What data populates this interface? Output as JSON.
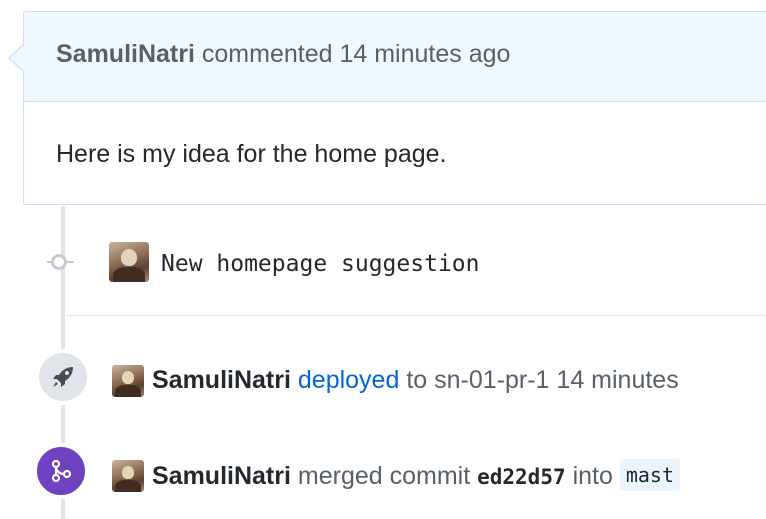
{
  "comment": {
    "author": "SamuliNatri",
    "action": "commented",
    "time": "14 minutes ago",
    "body": "Here is my idea for the home page."
  },
  "commit": {
    "message": "New homepage suggestion"
  },
  "deploy_event": {
    "author": "SamuliNatri",
    "action": "deployed",
    "connector": "to",
    "environment": "sn-01-pr-1",
    "time": "14 minutes"
  },
  "merge_event": {
    "author": "SamuliNatri",
    "action": "merged commit",
    "sha": "ed22d57",
    "connector": "into",
    "branch": "mast"
  },
  "colors": {
    "link": "#0366d6",
    "merged_purple": "#6f42c1",
    "header_bg": "#f1f8ff",
    "header_border": "#c8e1ff"
  },
  "icons": {
    "commit": "git-commit-icon",
    "deploy": "rocket-icon",
    "merge": "git-merge-icon"
  }
}
